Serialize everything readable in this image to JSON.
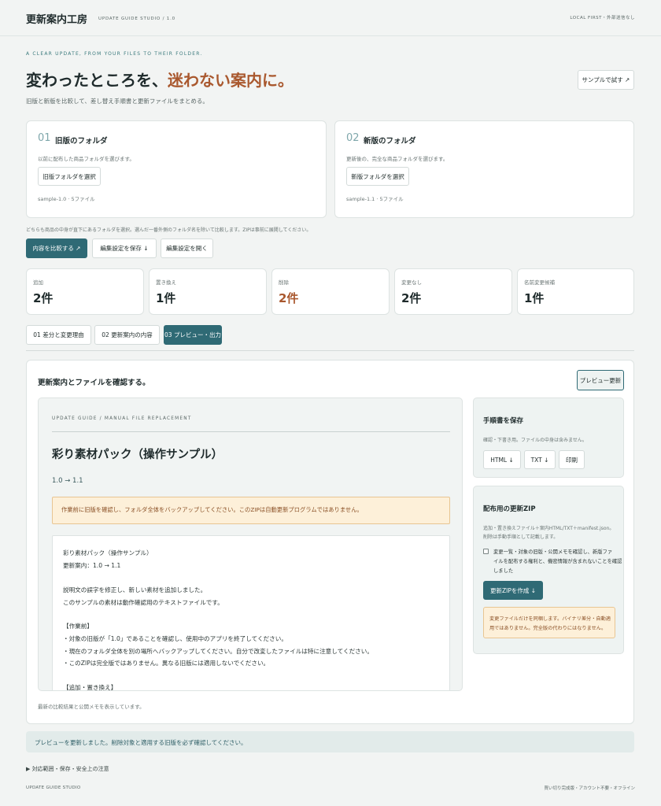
{
  "header": {
    "brand": "更新案内工房",
    "subbrand": "UPDATE GUIDE STUDIO / 1.0",
    "right_note": "LOCAL FIRST・外部送信なし"
  },
  "hero": {
    "tagline": "A CLEAR UPDATE, FROM YOUR FILES TO THEIR FOLDER.",
    "title_plain": "変わったところを、",
    "title_accent": "迷わない案内に。",
    "subtitle": "旧版と新版を比較して、差し替え手順書と更新ファイルをまとめる。",
    "sample_button": "サンプルで試す ↗"
  },
  "folders": {
    "old": {
      "num": "01",
      "title": "旧版のフォルダ",
      "desc": "以前に配布した商品フォルダを選びます。",
      "button": "旧版フォルダを選択",
      "status": "sample-1.0 · 5ファイル"
    },
    "new": {
      "num": "02",
      "title": "新版のフォルダ",
      "desc": "更新後の、完全な商品フォルダを選びます。",
      "button": "新版フォルダを選択",
      "status": "sample-1.1 · 5ファイル"
    },
    "note": "どちらも商品の中身が直下にあるフォルダを選択。選んだ一番外側のフォルダ名を除いて比較します。ZIPは事前に展開してください。"
  },
  "actions": {
    "compare": "内容を比較する ↗",
    "save_settings": "編集設定を保存 ↓",
    "open_settings": "編集設定を開く"
  },
  "stats": [
    {
      "label": "追加",
      "value": "2件",
      "accent": false
    },
    {
      "label": "置き換え",
      "value": "1件",
      "accent": false
    },
    {
      "label": "削除",
      "value": "2件",
      "accent": true
    },
    {
      "label": "変更なし",
      "value": "2件",
      "accent": false
    },
    {
      "label": "名前変更候補",
      "value": "1件",
      "accent": false
    }
  ],
  "tabs": [
    {
      "label": "01 差分と変更理由"
    },
    {
      "label": "02 更新案内の内容"
    },
    {
      "label": "03 プレビュー・出力"
    }
  ],
  "preview": {
    "heading": "更新案内とファイルを確認する。",
    "refresh": "プレビュー更新",
    "doc": {
      "kicker": "UPDATE GUIDE / MANUAL FILE REPLACEMENT",
      "title": "彩り素材パック（操作サンプル）",
      "version": "1.0 → 1.1",
      "warning": "作業前に旧版を確認し、フォルダ全体をバックアップしてください。このZIPは自動更新プログラムではありません。",
      "lines": [
        "彩り素材パック（操作サンプル）",
        "更新案内：1.0 → 1.1",
        "",
        "説明文の誤字を修正し、新しい素材を追加しました。",
        "このサンプルの素材は動作確認用のテキストファイルです。",
        "",
        "【作業前】",
        "・対象の旧版が「1.0」であることを確認し、使用中のアプリを終了してください。",
        "・現在のフォルダ全体を別の場所へバックアップしてください。自分で改変したファイルは特に注意してください。",
        "・このZIPは完全版ではありません。異なる旧版には適用しないでください。",
        "",
        "【追加・置き換え】"
      ]
    },
    "footnote": "最新の比較結果と公開メモを表示しています。",
    "manual": {
      "title": "手順書を保存",
      "desc": "確認・下書き用。ファイルの中身は含みません。",
      "html": "HTML ↓",
      "txt": "TXT ↓",
      "print": "印刷"
    },
    "zip": {
      "title": "配布用の更新ZIP",
      "desc1": "追加・置き換えファイル＋案内HTML/TXT＋manifest.json。",
      "desc2": "削除は手動手順として記載します。",
      "check1": "変更一覧・対象の旧版・公開メモを確認し、新版ファ",
      "check2": "イルを配布する権利と、機密情報が含まれないことを確認",
      "check3": "しました",
      "button": "更新ZIPを作成 ↓",
      "note1": "変更ファイルだけを同梱します。バイナリ差分・自動適",
      "note2": "用ではありません。完全版の代わりにはなりません。"
    }
  },
  "status": "プレビューを更新しました。削除対象と適用する旧版を必ず確認してください。",
  "details": "▶ 対応範囲・保存・安全上の注意",
  "footer": {
    "left": "UPDATE GUIDE STUDIO",
    "right": "買い切り完成版・アカウント不要・オフライン"
  },
  "colors": {
    "accent": "#2f6a75",
    "brand_orange": "#a9582e",
    "warning_bg": "#fdf0d9"
  }
}
